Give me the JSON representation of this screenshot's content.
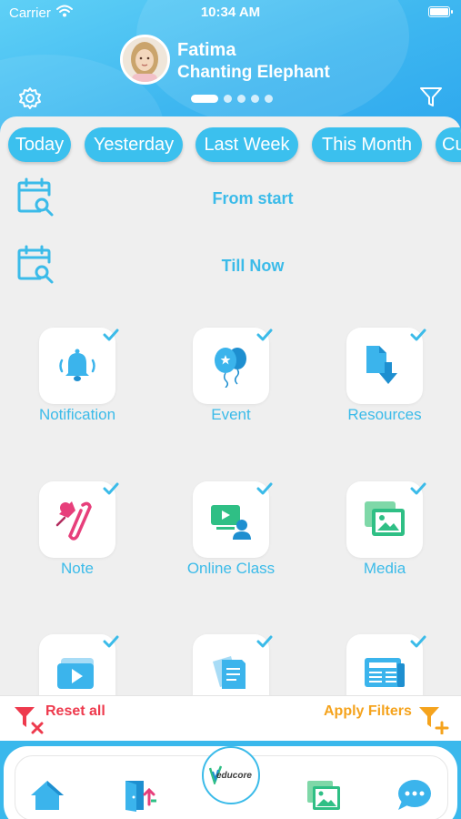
{
  "status": {
    "carrier": "Carrier",
    "time": "10:34 AM"
  },
  "profile": {
    "name": "Fatima",
    "class_name": "Chanting Elephant"
  },
  "pager": {
    "count": 5,
    "active": 0
  },
  "date_chips": [
    "Today",
    "Yesterday",
    "Last Week",
    "This Month",
    "Cu"
  ],
  "date_range": {
    "from_label": "From start",
    "to_label": "Till Now"
  },
  "categories": [
    {
      "label": "Notification",
      "icon": "bell-icon",
      "checked": true
    },
    {
      "label": "Event",
      "icon": "balloons-icon",
      "checked": true
    },
    {
      "label": "Resources",
      "icon": "download-file-icon",
      "checked": true
    },
    {
      "label": "Note",
      "icon": "pin-clip-icon",
      "checked": true
    },
    {
      "label": "Online Class",
      "icon": "video-teacher-icon",
      "checked": true
    },
    {
      "label": "Media",
      "icon": "gallery-icon",
      "checked": true
    },
    {
      "label": "",
      "icon": "video-icon",
      "checked": true
    },
    {
      "label": "",
      "icon": "documents-icon",
      "checked": true
    },
    {
      "label": "",
      "icon": "newspaper-icon",
      "checked": true
    }
  ],
  "actions": {
    "reset_label": "Reset all",
    "apply_label": "Apply Filters"
  },
  "bottom_nav": [
    {
      "name": "home-icon"
    },
    {
      "name": "door-icon"
    },
    {
      "name": "educore-logo",
      "text": "educore"
    },
    {
      "name": "gallery-icon"
    },
    {
      "name": "chat-icon"
    }
  ],
  "colors": {
    "accent": "#3bbbe9",
    "chip": "#3bc0ee",
    "reset": "#ee3a4d",
    "apply": "#f5a31d",
    "panel": "#efefef"
  }
}
